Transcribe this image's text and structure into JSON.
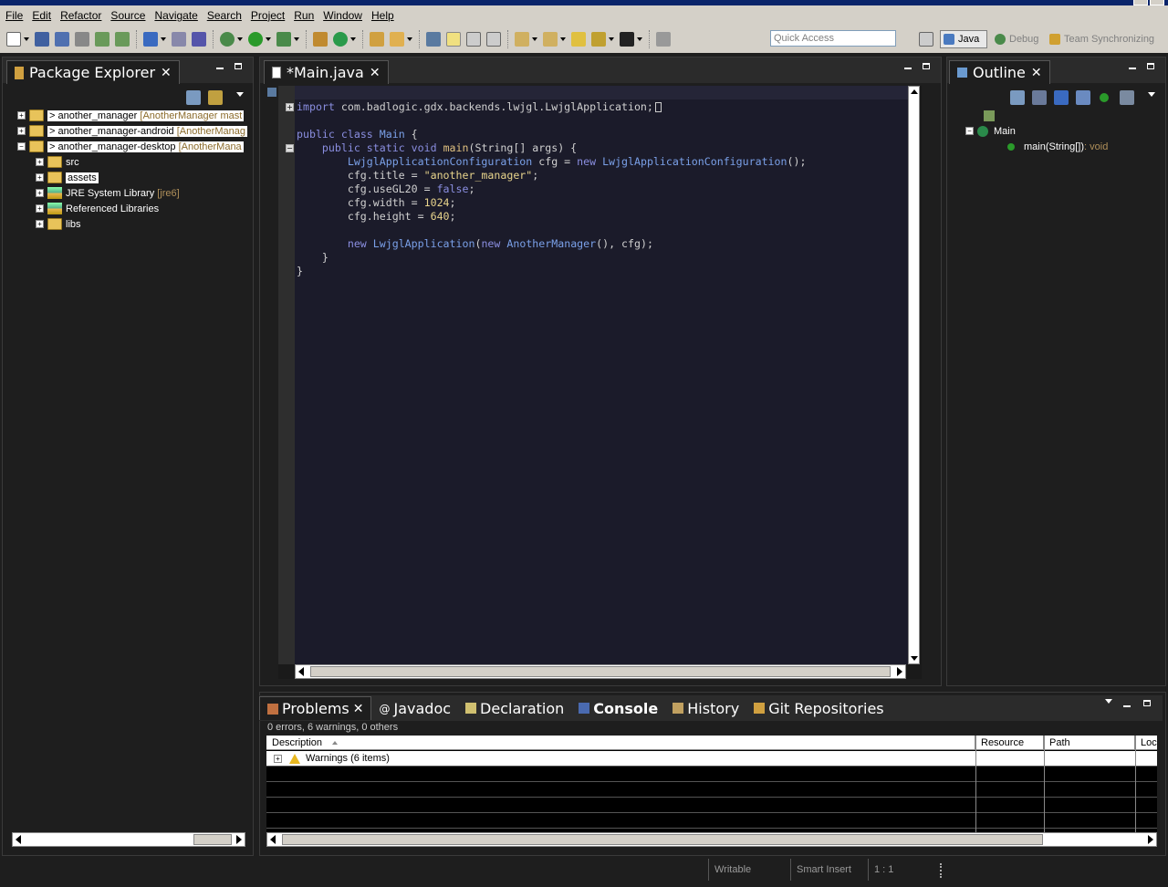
{
  "menubar": {
    "items": [
      "File",
      "Edit",
      "Refactor",
      "Source",
      "Navigate",
      "Search",
      "Project",
      "Run",
      "Window",
      "Help"
    ]
  },
  "toolbar": {
    "quick_access_placeholder": "Quick Access",
    "perspectives": {
      "java": "Java",
      "debug": "Debug",
      "team": "Team Synchronizing"
    }
  },
  "package_explorer": {
    "title": "Package Explorer",
    "projects": [
      {
        "name": "> another_manager",
        "decoration": "[AnotherManager mast"
      },
      {
        "name": "> another_manager-android",
        "decoration": "[AnotherManag"
      },
      {
        "name": "> another_manager-desktop",
        "decoration": "[AnotherMana"
      }
    ],
    "children": [
      {
        "label": "src",
        "suffix": ""
      },
      {
        "label": "assets",
        "suffix": ""
      },
      {
        "label": "JRE System Library",
        "suffix": "[jre6]"
      },
      {
        "label": "Referenced Libraries",
        "suffix": ""
      },
      {
        "label": "libs",
        "suffix": ""
      }
    ]
  },
  "editor": {
    "tab_title": "*Main.java",
    "code": {
      "import_kw": "import",
      "import_path": " com.badlogic.gdx.backends.lwjgl.LwjglApplication;",
      "line_public_class": [
        "public",
        " ",
        "class",
        " ",
        "Main",
        " {"
      ],
      "line_main": [
        "    ",
        "public",
        " ",
        "static",
        " ",
        "void",
        " ",
        "main",
        "(String[] args) {"
      ],
      "line_cfg": [
        "        ",
        "LwjglApplicationConfiguration",
        " cfg = ",
        "new",
        " ",
        "LwjglApplicationConfiguration",
        "();"
      ],
      "line_title": [
        "        cfg.title = ",
        "\"another_manager\"",
        ";"
      ],
      "line_gl20": [
        "        cfg.useGL20 = ",
        "false",
        ";"
      ],
      "line_width": [
        "        cfg.width = ",
        "1024",
        ";"
      ],
      "line_height": [
        "        cfg.height = ",
        "640",
        ";"
      ],
      "line_new": [
        "        ",
        "new",
        " ",
        "LwjglApplication",
        "(",
        "new",
        " ",
        "AnotherManager",
        "(), cfg);"
      ],
      "line_close1": "    }",
      "line_close2": "}"
    }
  },
  "outline": {
    "title": "Outline",
    "class_name": "Main",
    "method": "main(String[])",
    "method_type": " : void"
  },
  "bottom_panel": {
    "tabs": [
      "Problems",
      "Javadoc",
      "Declaration",
      "Console",
      "History",
      "Git Repositories"
    ],
    "summary": "0 errors, 6 warnings, 0 others",
    "columns": [
      "Description",
      "Resource",
      "Path",
      "Loc"
    ],
    "warnings_row": "Warnings (6 items)"
  },
  "statusbar": {
    "writable": "Writable",
    "insert_mode": "Smart Insert",
    "position": "1 : 1"
  },
  "colors": {
    "background": "#1e1e1e",
    "chrome": "#d4d0c8",
    "keyword": "#8a8ee0",
    "string": "#e8d48c"
  }
}
